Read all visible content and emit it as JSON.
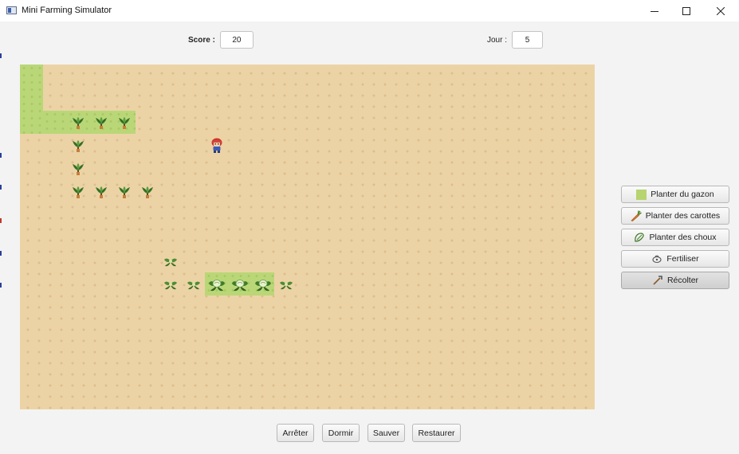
{
  "window": {
    "title": "Mini Farming Simulator",
    "controls": [
      "minimize",
      "maximize",
      "close"
    ]
  },
  "hud": {
    "score_label": "Score :",
    "score_value": "20",
    "day_label": "Jour :",
    "day_value": "5"
  },
  "colors": {
    "soil": "#ecd3a6",
    "grass": "#bad777",
    "button_pressed": "#d6d6d6"
  },
  "map": {
    "cell_size": 29,
    "grass_regions": [
      {
        "col": 0,
        "row": 0,
        "cols": 1,
        "rows": 3
      },
      {
        "col": 1,
        "row": 2,
        "cols": 4,
        "rows": 1
      },
      {
        "col": 8,
        "row": 9,
        "cols": 3,
        "rows": 1
      }
    ],
    "crops": [
      {
        "type": "carrot",
        "col": 2,
        "row": 2
      },
      {
        "type": "carrot",
        "col": 3,
        "row": 2
      },
      {
        "type": "carrot",
        "col": 4,
        "row": 2
      },
      {
        "type": "carrot",
        "col": 2,
        "row": 3
      },
      {
        "type": "carrot",
        "col": 2,
        "row": 4
      },
      {
        "type": "carrot",
        "col": 2,
        "row": 5
      },
      {
        "type": "carrot",
        "col": 3,
        "row": 5
      },
      {
        "type": "carrot",
        "col": 4,
        "row": 5
      },
      {
        "type": "carrot",
        "col": 5,
        "row": 5
      },
      {
        "type": "cabbage-small",
        "col": 6,
        "row": 8
      },
      {
        "type": "cabbage-small",
        "col": 6,
        "row": 9
      },
      {
        "type": "cabbage-small",
        "col": 7,
        "row": 9
      },
      {
        "type": "cabbage-large",
        "col": 8,
        "row": 9
      },
      {
        "type": "cabbage-large",
        "col": 9,
        "row": 9
      },
      {
        "type": "cabbage-large",
        "col": 10,
        "row": 9
      },
      {
        "type": "cabbage-small",
        "col": 11,
        "row": 9
      }
    ],
    "farmer": {
      "col": 8,
      "row": 3
    }
  },
  "actions": {
    "plant_grass": {
      "label": "Planter du gazon",
      "icon": "grass-square-icon"
    },
    "plant_carrots": {
      "label": "Planter des carottes",
      "icon": "carrot-icon"
    },
    "plant_cabbages": {
      "label": "Planter des choux",
      "icon": "cabbage-icon"
    },
    "fertilize": {
      "label": "Fertiliser",
      "icon": "fertilizer-icon"
    },
    "harvest": {
      "label": "Récolter",
      "icon": "hoe-icon",
      "selected": true
    }
  },
  "bottom": {
    "stop_label": "Arrêter",
    "sleep_label": "Dormir",
    "save_label": "Sauver",
    "restore_label": "Restaurer"
  }
}
